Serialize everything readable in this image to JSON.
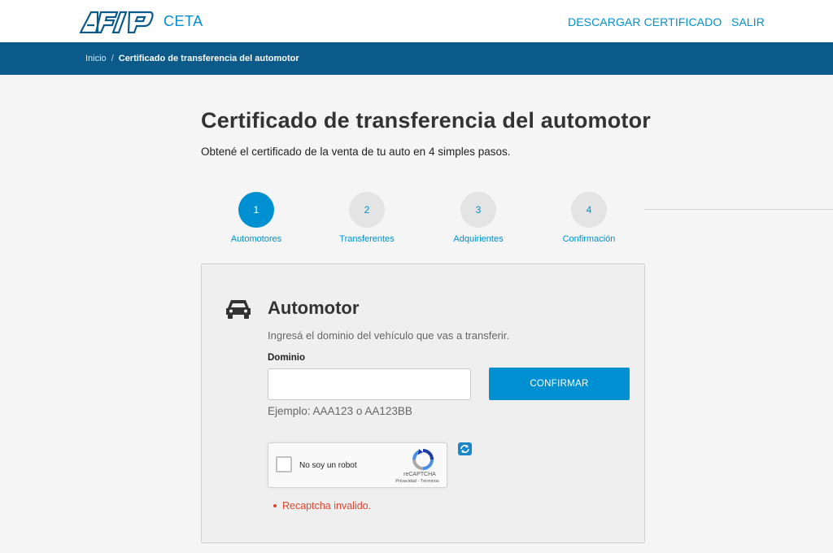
{
  "header": {
    "logo_text": "AFIP",
    "brand": "CETA",
    "nav": {
      "download_label": "DESCARGAR CERTIFICADO",
      "exit_label": "SALIR"
    }
  },
  "breadcrumb": {
    "home": "Inicio",
    "separator": "/",
    "current": "Certificado de transferencia del automotor"
  },
  "page": {
    "title": "Certificado de transferencia del automotor",
    "subtitle": "Obtené el certificado de la venta de tu auto en 4 simples pasos."
  },
  "stepper": {
    "active_step": 1,
    "steps": [
      {
        "number": "1",
        "label": "Automotores"
      },
      {
        "number": "2",
        "label": "Transferentes"
      },
      {
        "number": "3",
        "label": "Adquirientes"
      },
      {
        "number": "4",
        "label": "Confirmación"
      }
    ]
  },
  "form": {
    "icon": "car-icon",
    "title": "Automotor",
    "description": "Ingresá el dominio del vehículo que vas a transferir.",
    "field_label": "Dominio",
    "field_value": "",
    "field_placeholder": "",
    "confirm_label": "CONFIRMAR",
    "hint": "Ejemplo: AAA123 o AA123BB"
  },
  "captcha": {
    "checkbox_label": "No soy un robot",
    "brand": "reCAPTCHA",
    "links": "Privacidad - Términos",
    "checked": false,
    "reload_icon": "refresh-icon"
  },
  "error": {
    "message": "Recaptcha invalido."
  },
  "colors": {
    "accent": "#0090d1",
    "header_bar": "#0c5a8a",
    "error": "#e0452d",
    "step_inactive": "#e4e4e4"
  }
}
